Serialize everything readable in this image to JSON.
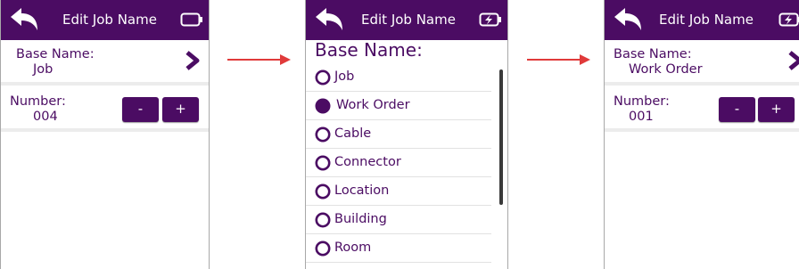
{
  "screens": [
    {
      "title": "Edit Job Name",
      "battery": "battery-empty-icon",
      "base_label": "Base Name:",
      "base_value": "Job",
      "number_label": "Number:",
      "number_value": "004",
      "minus": "-",
      "plus": "+"
    },
    {
      "title": "Edit Job Name",
      "battery": "battery-charging-icon",
      "list_header": "Base Name:",
      "options": [
        "Job",
        "Work Order",
        "Cable",
        "Connector",
        "Location",
        "Building",
        "Room"
      ],
      "selected": "Work Order"
    },
    {
      "title": "Edit Job Name",
      "battery": "battery-charging-icon",
      "base_label": "Base Name:",
      "base_value": "Work Order",
      "number_label": "Number:",
      "number_value": "001",
      "minus": "-",
      "plus": "+"
    }
  ],
  "colors": {
    "accent": "#4b0c63",
    "arrow": "#e03a3a",
    "separator": "#ececec"
  }
}
